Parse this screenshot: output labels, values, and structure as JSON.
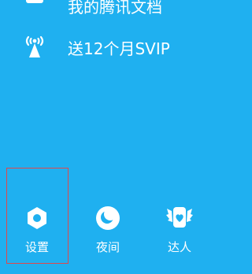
{
  "menu": {
    "items": [
      {
        "label": "我的腾讯文档",
        "icon": "document-box-icon"
      },
      {
        "label": "送12个月SVIP",
        "icon": "broadcast-tower-icon"
      }
    ]
  },
  "bottom_bar": {
    "buttons": [
      {
        "label": "设置",
        "icon": "settings-icon"
      },
      {
        "label": "夜间",
        "icon": "night-mode-icon"
      },
      {
        "label": "达人",
        "icon": "expert-badge-icon"
      }
    ]
  },
  "colors": {
    "background": "#1fb0f0",
    "foreground": "#ffffff",
    "highlight": "#e0474c"
  }
}
